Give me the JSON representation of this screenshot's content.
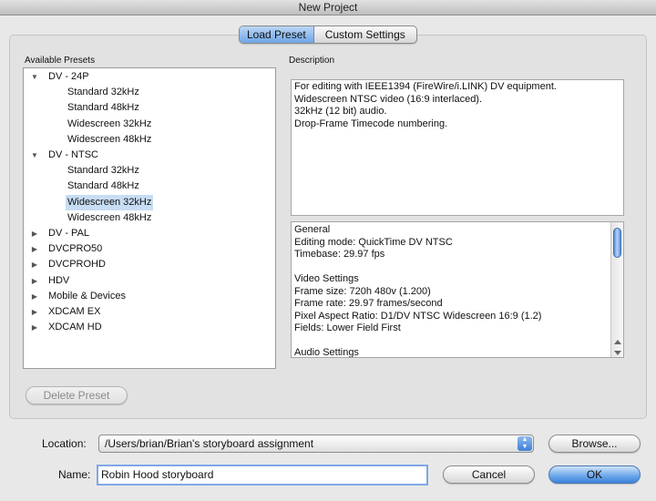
{
  "window": {
    "title": "New Project"
  },
  "tabs": [
    {
      "label": "Load Preset",
      "active": true
    },
    {
      "label": "Custom Settings",
      "active": false
    }
  ],
  "presets": {
    "header": "Available Presets",
    "items": [
      {
        "label": "DV - 24P",
        "expanded": true,
        "level": 0
      },
      {
        "label": "Standard 32kHz",
        "level": 1
      },
      {
        "label": "Standard 48kHz",
        "level": 1
      },
      {
        "label": "Widescreen 32kHz",
        "level": 1
      },
      {
        "label": "Widescreen 48kHz",
        "level": 1
      },
      {
        "label": "DV - NTSC",
        "expanded": true,
        "level": 0
      },
      {
        "label": "Standard 32kHz",
        "level": 1
      },
      {
        "label": "Standard 48kHz",
        "level": 1
      },
      {
        "label": "Widescreen 32kHz",
        "level": 1,
        "selected": true
      },
      {
        "label": "Widescreen 48kHz",
        "level": 1
      },
      {
        "label": "DV - PAL",
        "expanded": false,
        "level": 0
      },
      {
        "label": "DVCPRO50",
        "expanded": false,
        "level": 0
      },
      {
        "label": "DVCPROHD",
        "expanded": false,
        "level": 0
      },
      {
        "label": "HDV",
        "expanded": false,
        "level": 0
      },
      {
        "label": "Mobile & Devices",
        "expanded": false,
        "level": 0
      },
      {
        "label": "XDCAM EX",
        "expanded": false,
        "level": 0
      },
      {
        "label": "XDCAM HD",
        "expanded": false,
        "level": 0
      }
    ],
    "delete_button": "Delete Preset"
  },
  "description": {
    "header": "Description",
    "lines": [
      "For editing with IEEE1394 (FireWire/i.LINK) DV equipment.",
      "Widescreen NTSC video (16:9 interlaced).",
      "32kHz (12 bit) audio.",
      "Drop-Frame Timecode numbering."
    ]
  },
  "settings": {
    "lines": [
      "General",
      " Editing mode: QuickTime DV NTSC",
      " Timebase: 29.97 fps",
      "",
      "Video Settings",
      " Frame size: 720h 480v (1.200)",
      " Frame rate: 29.97 frames/second",
      " Pixel Aspect Ratio: D1/DV NTSC Widescreen 16:9 (1.2)",
      " Fields: Lower Field First",
      "",
      "Audio Settings"
    ]
  },
  "location": {
    "label": "Location:",
    "value": "/Users/brian/Brian's storyboard assignment",
    "browse_button": "Browse..."
  },
  "name": {
    "label": "Name:",
    "value": "Robin Hood storyboard"
  },
  "buttons": {
    "cancel": "Cancel",
    "ok": "OK"
  },
  "colors": {
    "accent": "#6ea5e6",
    "selection": "#c7ddf4"
  }
}
